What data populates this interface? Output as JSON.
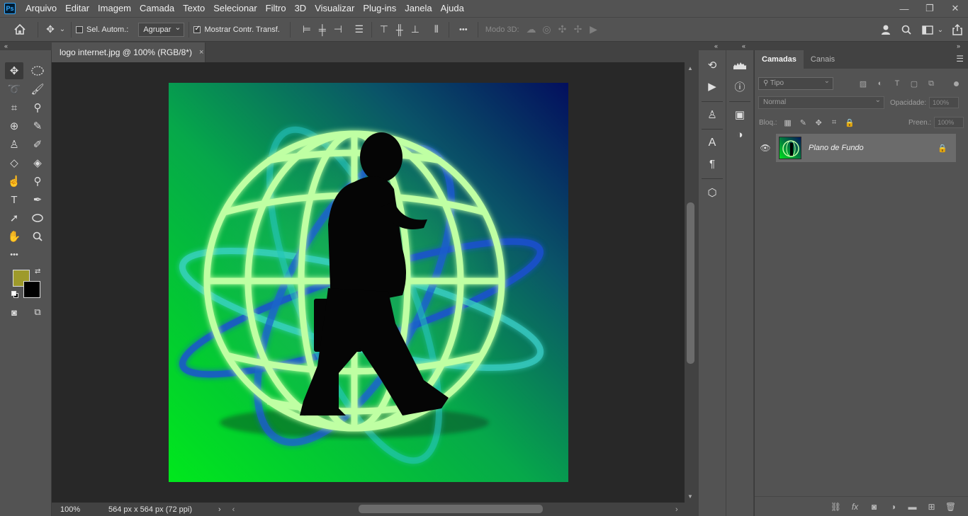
{
  "app": {
    "logo": "Ps"
  },
  "menu": [
    "Arquivo",
    "Editar",
    "Imagem",
    "Camada",
    "Texto",
    "Selecionar",
    "Filtro",
    "3D",
    "Visualizar",
    "Plug-ins",
    "Janela",
    "Ajuda"
  ],
  "window_controls": {
    "minimize": "—",
    "restore": "❐",
    "close": "✕"
  },
  "options": {
    "auto_select_label": "Sel. Autom.:",
    "auto_select_checked": false,
    "group_value": "Agrupar",
    "show_transform_label": "Mostrar Contr. Transf.",
    "show_transform_checked": true,
    "more": "•••",
    "mode_3d_label": "Modo 3D:"
  },
  "document": {
    "tab_title": "logo internet.jpg @ 100% (RGB/8*)",
    "close": "×"
  },
  "status": {
    "zoom": "100%",
    "doc_size": "564 px x 564 px (72 ppi)",
    "arrow": "›",
    "scroll_left": "‹",
    "scroll_right": "›"
  },
  "layers_panel": {
    "tabs": [
      "Camadas",
      "Canais"
    ],
    "filter_placeholder": "Tipo",
    "blend_mode": "Normal",
    "opacity_label": "Opacidade:",
    "opacity_value": "100%",
    "lock_label": "Bloq.:",
    "fill_label": "Preen.:",
    "fill_value": "100%",
    "layers": [
      {
        "name": "Plano de Fundo",
        "visible": true,
        "locked": true
      }
    ]
  },
  "colors": {
    "foreground": "#9e9a2b",
    "background": "#000000",
    "accent": "#31a8ff"
  }
}
